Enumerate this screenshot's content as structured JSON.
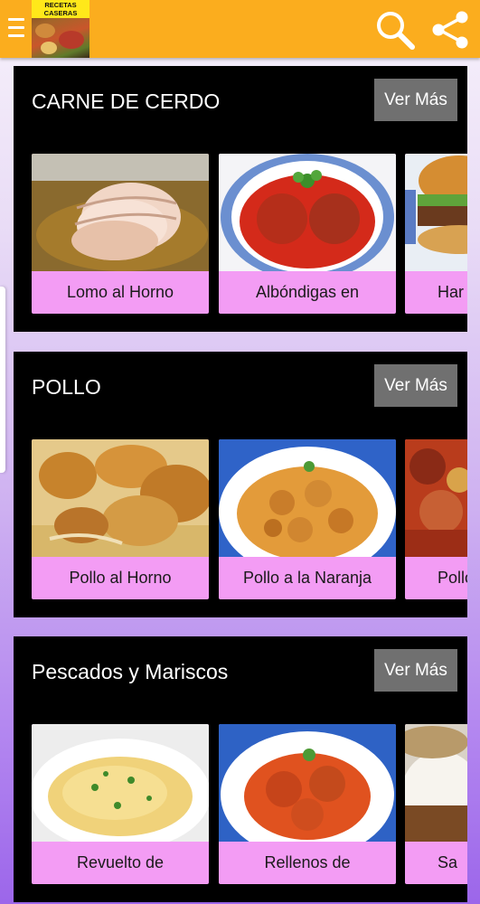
{
  "app": {
    "logo_text": "RECETAS CASERAS"
  },
  "sections": [
    {
      "title": "CARNE DE CERDO",
      "more_label": "Ver Más",
      "cards": [
        {
          "label": "Lomo al Horno"
        },
        {
          "label": "Albóndigas en"
        },
        {
          "label": "Har"
        }
      ]
    },
    {
      "title": "POLLO",
      "more_label": "Ver Más",
      "cards": [
        {
          "label": "Pollo al Horno"
        },
        {
          "label": "Pollo a la Naranja"
        },
        {
          "label": "Pollo"
        }
      ]
    },
    {
      "title": "Pescados y Mariscos",
      "more_label": "Ver Más",
      "cards": [
        {
          "label": "Revuelto de"
        },
        {
          "label": "Rellenos de"
        },
        {
          "label": "Sa"
        }
      ]
    }
  ],
  "colors": {
    "appbar": "#fbad1e",
    "section_bg": "#000000",
    "card_label_bg": "#f39cf4",
    "button_bg": "#707070"
  }
}
